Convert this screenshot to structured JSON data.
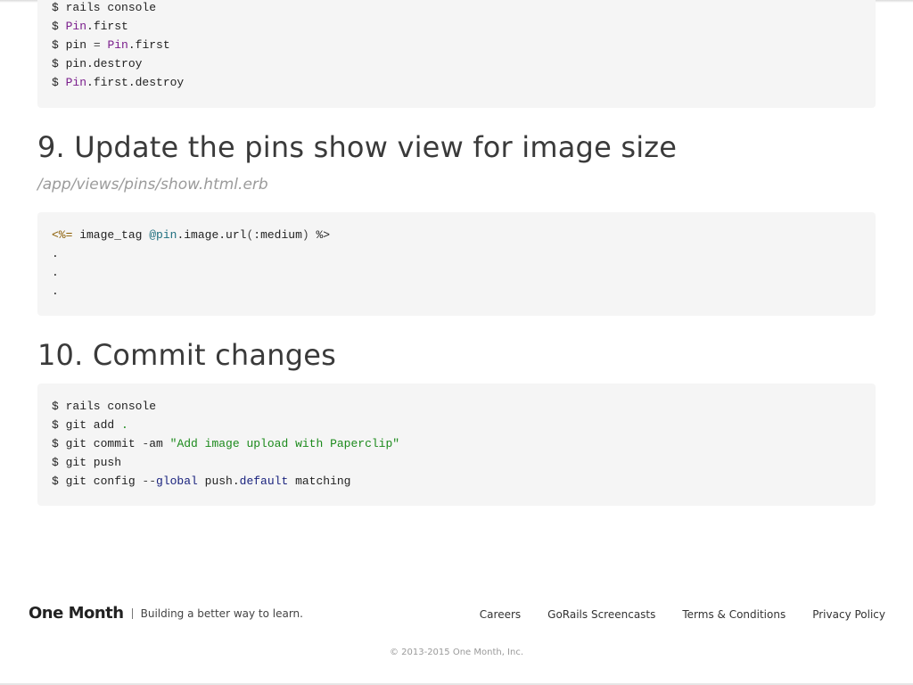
{
  "code_block_1": {
    "lines": [
      [
        {
          "t": "$ rails console"
        }
      ],
      [
        {
          "t": "$ "
        },
        {
          "t": "Pin",
          "c": "const"
        },
        {
          "t": ".first"
        }
      ],
      [
        {
          "t": "$ pin "
        },
        {
          "t": "=",
          "c": "op"
        },
        {
          "t": " "
        },
        {
          "t": "Pin",
          "c": "const"
        },
        {
          "t": ".first"
        }
      ],
      [
        {
          "t": "$ pin.destroy"
        }
      ],
      [
        {
          "t": "$ "
        },
        {
          "t": "Pin",
          "c": "const"
        },
        {
          "t": ".first.destroy"
        }
      ]
    ]
  },
  "section_9": {
    "heading": "9. Update the pins show view for image size",
    "file_path": "/app/views/pins/show.html.erb",
    "code": {
      "lines": [
        [
          {
            "t": "<%=",
            "c": "erb"
          },
          {
            "t": " image_tag "
          },
          {
            "t": "@pin",
            "c": "ivar"
          },
          {
            "t": ".image.url"
          },
          {
            "t": "(",
            "c": "op"
          },
          {
            "t": ":medium"
          },
          {
            "t": ")",
            "c": "op"
          },
          {
            "t": " %>"
          }
        ],
        [
          {
            "t": "."
          }
        ],
        [
          {
            "t": "."
          }
        ],
        [
          {
            "t": "."
          }
        ]
      ]
    }
  },
  "section_10": {
    "heading": "10. Commit changes",
    "code": {
      "lines": [
        [
          {
            "t": "$ rails console"
          }
        ],
        [
          {
            "t": "$ git add "
          },
          {
            "t": ".",
            "c": "str"
          }
        ],
        [
          {
            "t": "$ git commit "
          },
          {
            "t": "-",
            "c": "op"
          },
          {
            "t": "am "
          },
          {
            "t": "\"Add image upload with Paperclip\"",
            "c": "str"
          }
        ],
        [
          {
            "t": "$ git push"
          }
        ],
        [
          {
            "t": "$ git config "
          },
          {
            "t": "--",
            "c": "op"
          },
          {
            "t": "global",
            "c": "flag"
          },
          {
            "t": " push."
          },
          {
            "t": "default",
            "c": "flag"
          },
          {
            "t": " matching"
          }
        ]
      ]
    }
  },
  "footer": {
    "brand": "One Month",
    "tagline": "Building a better way to learn.",
    "links": {
      "careers": "Careers",
      "gorails": "GoRails Screencasts",
      "terms": "Terms & Conditions",
      "privacy": "Privacy Policy"
    },
    "copyright": "© 2013-2015 One Month, Inc."
  },
  "colors": {
    "code_bg": "#f5f5f5",
    "constant": "#7a1e8c",
    "string": "#1c8a1c",
    "instance_var": "#1f6f7f",
    "keyword": "#1a237e"
  }
}
